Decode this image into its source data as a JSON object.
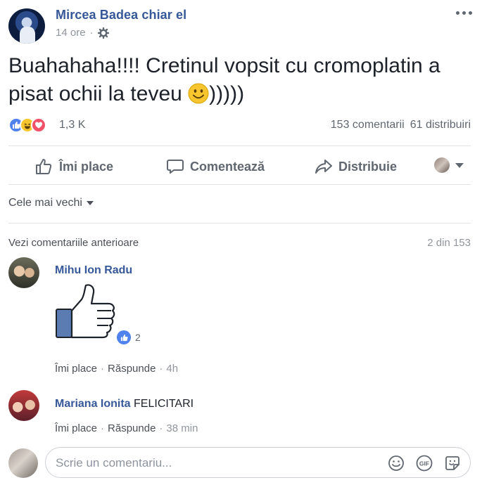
{
  "post": {
    "author": "Mircea Badea chiar el",
    "time": "14 ore",
    "text_main": "Buahahaha!!!! Cretinul vopsit cu cromoplatin a pisat ochii la teveu ",
    "text_tail": ")))))",
    "icons": {
      "privacy": "gear-icon",
      "more": "more-options-icon",
      "emoji": "smile-emoji-icon"
    }
  },
  "reactions": {
    "types": [
      "like",
      "haha",
      "love"
    ],
    "count": "1,3 K",
    "comments": "153 comentarii",
    "shares": "61 distribuiri"
  },
  "actions": {
    "like": "Îmi place",
    "comment": "Comentează",
    "share": "Distribuie"
  },
  "sort": {
    "label": "Cele mai vechi"
  },
  "previous": {
    "link": "Vezi comentariile anterioare",
    "count": "2 din 153"
  },
  "comments": [
    {
      "author": "Mihu Ion Radu",
      "text": "",
      "sticker": "thumbs-up-sticker",
      "likes": "2",
      "like_label": "Îmi place",
      "reply_label": "Răspunde",
      "time": "4h"
    },
    {
      "author": "Mariana Ionita",
      "text": "FELICITARI",
      "like_label": "Îmi place",
      "reply_label": "Răspunde",
      "time": "38 min"
    }
  ],
  "composer": {
    "placeholder": "Scrie un comentariu..."
  },
  "colors": {
    "link": "#365899",
    "like_blue": "#4f82ee",
    "haha_yellow": "#f7c62f",
    "love_red": "#f25268",
    "meta_gray": "#90949c"
  }
}
